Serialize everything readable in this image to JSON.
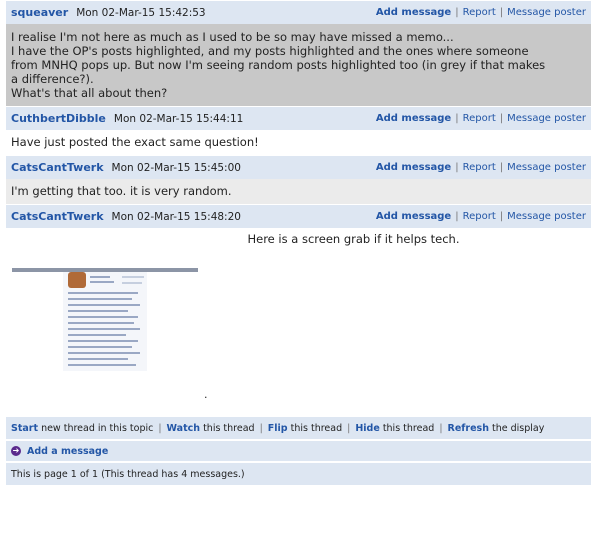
{
  "actions": {
    "add_message": "Add message",
    "report": "Report",
    "message_poster": "Message poster",
    "separator": "|"
  },
  "posts": [
    {
      "author": "squeaver",
      "timestamp": "Mon 02-Mar-15 15:42:53",
      "body": [
        "I realise I'm not here as much as I used to be so may have missed a memo...",
        "",
        "I have the OP's posts highlighted, and my posts highlighted and the ones where someone\nfrom MNHQ pops up. But now I'm seeing random posts highlighted too (in grey if that makes\na difference?).",
        "",
        "What's that all about then?"
      ]
    },
    {
      "author": "CuthbertDibble",
      "timestamp": "Mon 02-Mar-15 15:44:11",
      "body": [
        "Have just posted the exact same question!"
      ]
    },
    {
      "author": "CatsCantTwerk",
      "timestamp": "Mon 02-Mar-15 15:45:00",
      "body": [
        "I'm getting that too. it is very random."
      ]
    },
    {
      "author": "CatsCantTwerk",
      "timestamp": "Mon 02-Mar-15 15:48:20",
      "caption": "Here is a screen grab if it helps tech.",
      "trailing": "."
    }
  ],
  "footer": {
    "start_kw": "Start",
    "start_rest": "new thread in this topic",
    "watch_kw": "Watch",
    "watch_rest": "this thread",
    "flip_kw": "Flip",
    "flip_rest": "this thread",
    "hide_kw": "Hide",
    "hide_rest": "this thread",
    "refresh_kw": "Refresh",
    "refresh_rest": "the display",
    "separator": "|"
  },
  "add_message_label": "Add a message",
  "page_info": "This is page 1 of 1 (This thread has 4 messages.)",
  "colors": {
    "header_bg": "#dde6f2",
    "link": "#2356a6",
    "highlight_grey": "#c8c8c8",
    "icon_purple": "#5b2a8c"
  },
  "icons": {
    "add_message": "plus-circle-icon"
  }
}
